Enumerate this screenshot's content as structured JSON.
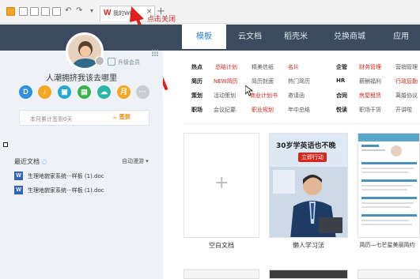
{
  "window": {
    "tab_title": "我的WPS",
    "tab_logo": "W",
    "tab_close": "×",
    "tab_add": "+",
    "annotation": "点击关闭",
    "accent": "#d9251c"
  },
  "sidebar": {
    "username": "人潮拥挤我该去哪里",
    "upgrade_label": "升级会员",
    "apps": [
      {
        "glyph": "D",
        "color": "#2f8fe0",
        "icon": "docs-icon"
      },
      {
        "glyph": "♪",
        "color": "#f5a623",
        "icon": "audio-icon"
      },
      {
        "glyph": "▣",
        "color": "#27a8d0",
        "icon": "cloud-doc-icon"
      },
      {
        "glyph": "▤",
        "color": "#3ab44a",
        "icon": "calendar-icon"
      },
      {
        "glyph": "☁",
        "color": "#2db7a4",
        "icon": "cloud-icon"
      },
      {
        "glyph": "月",
        "color": "#f5a623",
        "icon": "month-icon"
      },
      {
        "glyph": "···",
        "color": "#c9ced6",
        "icon": "more-icon"
      }
    ],
    "checkin_text": "本月累计签到0天",
    "checkin_button": "签到",
    "recent_title": "最近文档",
    "sync_label": "自动漫游",
    "recent_files": [
      "生理地貌家系统···样板 (1).doc",
      "生理地貌家系统···样板 (1).doc"
    ]
  },
  "nav": {
    "tabs": [
      "模板",
      "云文档",
      "稻壳米",
      "兑换商城",
      "应用"
    ],
    "active": "模板"
  },
  "categories": {
    "col1": [
      {
        "head": "热点",
        "items": [
          {
            "text": "总结计划",
            "red": true
          },
          {
            "text": "精美信纸",
            "red": false
          },
          {
            "text": "名片",
            "red": true
          }
        ]
      },
      {
        "head": "简历",
        "items": [
          {
            "text": "NEW简历",
            "red": true
          },
          {
            "text": "简历封面",
            "red": false
          },
          {
            "text": "热门简历",
            "red": false
          }
        ]
      },
      {
        "head": "策划",
        "items": [
          {
            "text": "活动策划",
            "red": false
          },
          {
            "text": "商业计划书",
            "red": true
          },
          {
            "text": "邀请函",
            "red": false
          }
        ]
      },
      {
        "head": "职场",
        "items": [
          {
            "text": "会议纪要",
            "red": false
          },
          {
            "text": "职业规划",
            "red": true
          },
          {
            "text": "年中总结",
            "red": false
          }
        ]
      }
    ],
    "col2": [
      {
        "head": "企管",
        "items": [
          {
            "text": "财务管理",
            "red": true
          },
          {
            "text": "营销管理",
            "red": false
          }
        ]
      },
      {
        "head": "HR",
        "items": [
          {
            "text": "薪酬福利",
            "red": false
          },
          {
            "text": "行政后勤",
            "red": true
          }
        ]
      },
      {
        "head": "合同",
        "items": [
          {
            "text": "房屋租赁",
            "red": true
          },
          {
            "text": "离婚协议",
            "red": false
          }
        ]
      },
      {
        "head": "悦读",
        "items": [
          {
            "text": "职场干货",
            "red": false
          },
          {
            "text": "开讲啦",
            "red": false
          }
        ]
      }
    ]
  },
  "cards": [
    {
      "label": "空白文档",
      "plus": "+"
    },
    {
      "label": "懒人学习法",
      "title": "30岁学英语也不晚",
      "button": "立即行动"
    },
    {
      "label": "简历—七芒星美丽简约"
    }
  ]
}
